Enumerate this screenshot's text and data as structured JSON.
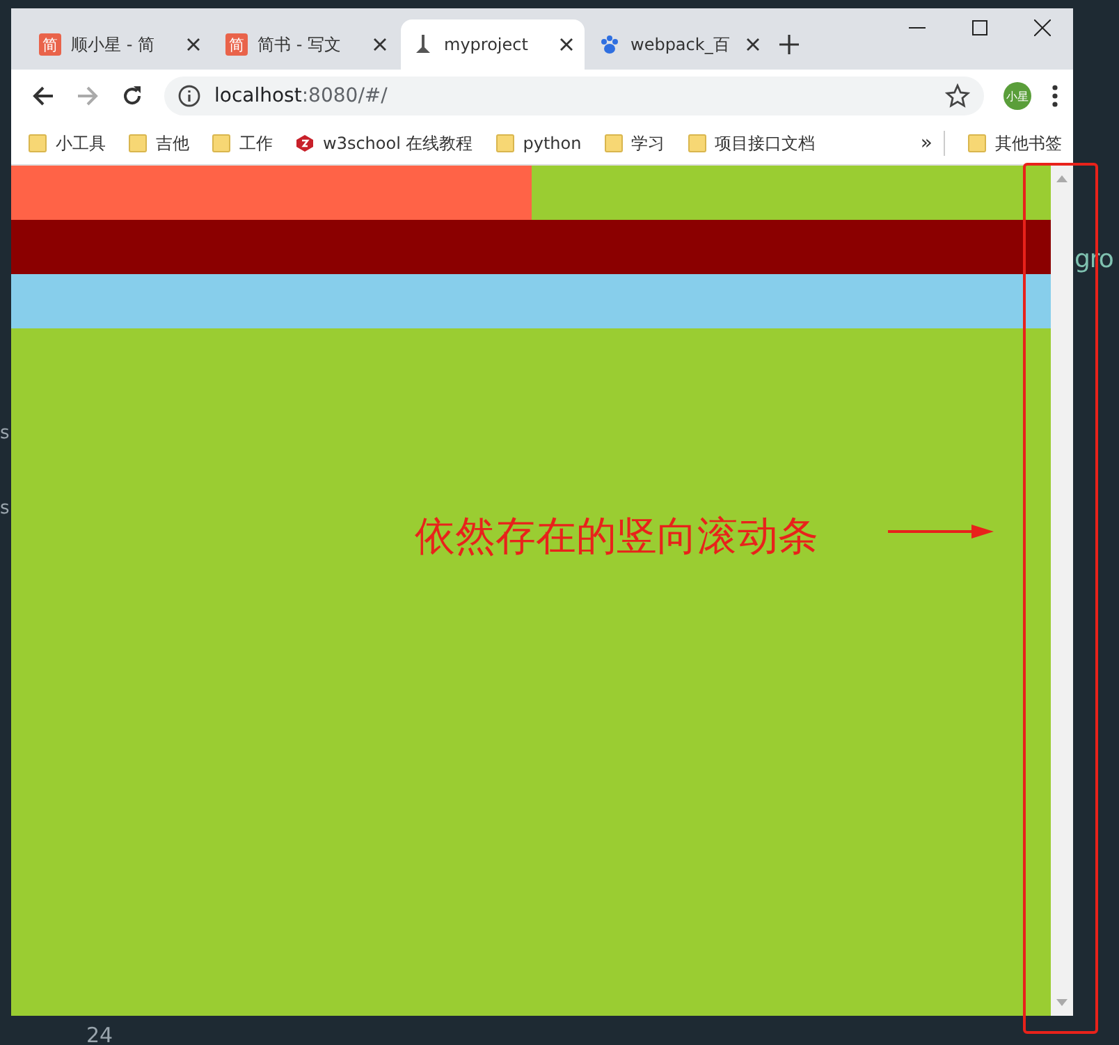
{
  "editor": {
    "texts": [
      {
        "text": "gro",
        "kind": "code"
      },
      {
        "text": "s",
        "kind": "side"
      },
      {
        "text": "s",
        "kind": "side2"
      },
      {
        "text": "24",
        "kind": "line"
      }
    ]
  },
  "browser": {
    "tabs": [
      {
        "title": "顺小星 - 简",
        "kind": "text",
        "icon": "简",
        "selected": false
      },
      {
        "title": "简书 - 写文",
        "kind": "text",
        "icon": "简",
        "selected": false
      },
      {
        "title": "myproject",
        "kind": "figure",
        "selected": true
      },
      {
        "title": "webpack_百",
        "kind": "paw",
        "selected": false
      }
    ],
    "address": {
      "host": "localhost",
      "path": ":8080/#/"
    },
    "avatar": "小星",
    "bookmarks": [
      {
        "label": "小工具",
        "kind": "folder"
      },
      {
        "label": "吉他",
        "kind": "folder"
      },
      {
        "label": "工作",
        "kind": "folder"
      },
      {
        "label": "w3school 在线教程",
        "kind": "site"
      },
      {
        "label": "python",
        "kind": "folder"
      },
      {
        "label": "学习",
        "kind": "folder"
      },
      {
        "label": "项目接口文档",
        "kind": "folder"
      }
    ],
    "overflow": "»",
    "other_bookmarks": "其他书签",
    "page": {
      "rows": [
        {
          "cells": [
            {
              "color": "#ff6347"
            },
            {
              "color": "#9acd32"
            }
          ]
        },
        {
          "cells": [
            {
              "color": "#8b0000"
            }
          ]
        },
        {
          "cells": [
            {
              "color": "#87ceeb"
            }
          ]
        },
        {
          "cells": [
            {
              "color": "#9acd32"
            }
          ],
          "fill": true
        }
      ]
    }
  },
  "annotation": {
    "text": "依然存在的竖向滚动条"
  }
}
